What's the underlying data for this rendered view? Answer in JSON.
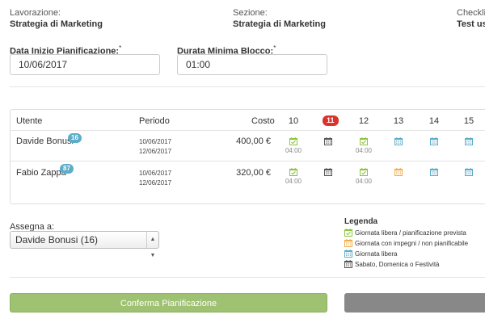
{
  "header": {
    "lavorazione_label": "Lavorazione:",
    "lavorazione_value": "Strategia di Marketing",
    "sezione_label": "Sezione:",
    "sezione_value": "Strategia di Marketing",
    "checklist_label": "Checklis",
    "checklist_value": "Test use"
  },
  "form": {
    "data_inizio_label": "Data Inizio Pianificazione:",
    "data_inizio_value": "10/06/2017",
    "durata_label": "Durata Minima Blocco:",
    "durata_value": "01:00",
    "required_mark": "*"
  },
  "table": {
    "headers": {
      "utente": "Utente",
      "periodo": "Periodo",
      "costo": "Costo"
    },
    "days": [
      "10",
      "11",
      "12",
      "13",
      "14",
      "15"
    ],
    "today_index": 1,
    "rows": [
      {
        "name": "Davide Bonusi",
        "badge": "16",
        "start": "10/06/2017",
        "end": "12/06/2017",
        "cost": "400,00 €",
        "cells": [
          {
            "type": "free-planned",
            "time": "04:00"
          },
          {
            "type": "holiday",
            "time": ""
          },
          {
            "type": "free-planned",
            "time": "04:00"
          },
          {
            "type": "free",
            "time": ""
          },
          {
            "type": "free",
            "time": ""
          },
          {
            "type": "free",
            "time": ""
          }
        ]
      },
      {
        "name": "Fabio Zappa",
        "badge": "87",
        "start": "10/06/2017",
        "end": "12/06/2017",
        "cost": "320,00 €",
        "cells": [
          {
            "type": "free-planned",
            "time": "04:00"
          },
          {
            "type": "holiday",
            "time": ""
          },
          {
            "type": "free-planned",
            "time": "04:00"
          },
          {
            "type": "busy",
            "time": ""
          },
          {
            "type": "free",
            "time": ""
          },
          {
            "type": "free",
            "time": ""
          }
        ]
      }
    ]
  },
  "assign": {
    "label": "Assegna a:",
    "selected": "Davide Bonusi (16)"
  },
  "legend": {
    "title": "Legenda",
    "items": [
      {
        "type": "free-planned",
        "label": "Giornata libera / pianificazione prevista"
      },
      {
        "type": "busy",
        "label": "Giornata con impegni / non pianificabile"
      },
      {
        "type": "free",
        "label": "Giornata libera"
      },
      {
        "type": "holiday",
        "label": "Sabato, Domenica o Festività"
      }
    ]
  },
  "colors": {
    "free-planned": "#8dc63f",
    "busy": "#f0ad4e",
    "free": "#5dadc9",
    "holiday": "#555555",
    "confirm_button": "#9fc172"
  },
  "actions": {
    "confirm_label": "Conferma Pianificazione"
  }
}
